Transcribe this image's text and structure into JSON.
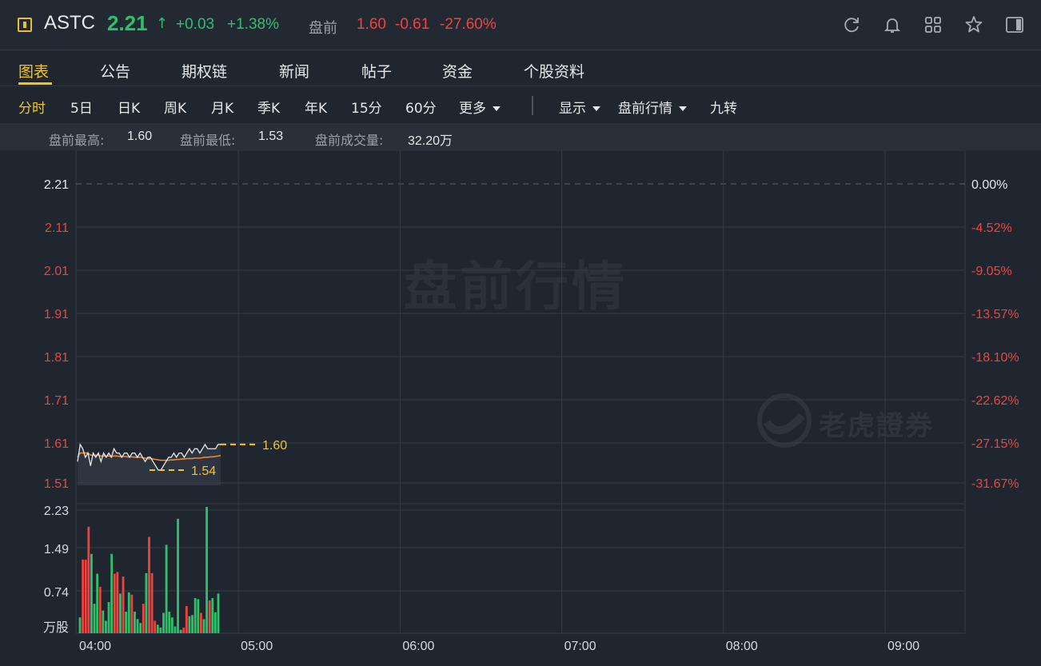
{
  "header": {
    "symbol": "ASTC",
    "price": "2.21",
    "price_arrow": "↑",
    "change": "+0.03",
    "change_pct": "+1.38%",
    "premarket_label": "盘前",
    "premarket_price": "1.60",
    "premarket_change": "-0.61",
    "premarket_change_pct": "-27.60%",
    "icons": [
      "refresh-icon",
      "bell-icon",
      "grid-icon",
      "star-icon",
      "sidebar-toggle-icon"
    ]
  },
  "tabs": [
    {
      "label": "图表",
      "active": true
    },
    {
      "label": "公告",
      "active": false
    },
    {
      "label": "期权链",
      "active": false
    },
    {
      "label": "新闻",
      "active": false
    },
    {
      "label": "帖子",
      "active": false
    },
    {
      "label": "资金",
      "active": false
    },
    {
      "label": "个股资料",
      "active": false
    }
  ],
  "toolbar": {
    "periods": [
      "分时",
      "5日",
      "日K",
      "周K",
      "月K",
      "季K",
      "年K",
      "15分",
      "60分"
    ],
    "active_period": "分时",
    "more": "更多",
    "display": "显示",
    "premarket": "盘前行情",
    "nine_turn": "九转"
  },
  "stats": {
    "high_label": "盘前最高:",
    "high_value": "1.60",
    "low_label": "盘前最低:",
    "low_value": "1.53",
    "volume_label": "盘前成交量:",
    "volume_value": "32.20万"
  },
  "chart": {
    "watermark": "盘前行情",
    "brand_watermark": "老虎證券",
    "colors": {
      "up": "#f0433f",
      "down": "#2fc06a",
      "accent": "#f5c518",
      "avg_line": "#e88a2c",
      "price_line": "#e6e8ea"
    }
  },
  "chart_data": {
    "type": "line",
    "price_axis_left": [
      "2.21",
      "2.11",
      "2.01",
      "1.91",
      "1.81",
      "1.71",
      "1.61",
      "1.51"
    ],
    "price_axis_right": [
      "0.00%",
      "-4.52%",
      "-9.05%",
      "-13.57%",
      "-18.10%",
      "-22.62%",
      "-27.15%",
      "-31.67%"
    ],
    "volume_axis": [
      "2.23",
      "1.49",
      "0.74",
      "万股"
    ],
    "time_axis": [
      "04:00",
      "05:00",
      "06:00",
      "07:00",
      "08:00",
      "09:00"
    ],
    "ylim": [
      1.49,
      2.23
    ],
    "prev_close": 2.21,
    "high_marker": "1.60",
    "low_marker": "1.54",
    "price": [
      1.56,
      1.6,
      1.59,
      1.57,
      1.58,
      1.55,
      1.58,
      1.57,
      1.58,
      1.56,
      1.58,
      1.57,
      1.58,
      1.57,
      1.59,
      1.58,
      1.58,
      1.57,
      1.58,
      1.58,
      1.57,
      1.58,
      1.58,
      1.57,
      1.58,
      1.57,
      1.56,
      1.57,
      1.57,
      1.56,
      1.55,
      1.54,
      1.54,
      1.55,
      1.56,
      1.57,
      1.57,
      1.58,
      1.57,
      1.58,
      1.58,
      1.57,
      1.58,
      1.59,
      1.58,
      1.59,
      1.59,
      1.58,
      1.59,
      1.6,
      1.59,
      1.59,
      1.59,
      1.59,
      1.6,
      1.6
    ],
    "avg": [
      1.57,
      1.58,
      1.58,
      1.58,
      1.58,
      1.575,
      1.575,
      1.575,
      1.575,
      1.573,
      1.573,
      1.573,
      1.573,
      1.572,
      1.573,
      1.573,
      1.572,
      1.572,
      1.572,
      1.571,
      1.571,
      1.571,
      1.57,
      1.57,
      1.57,
      1.569,
      1.568,
      1.567,
      1.567,
      1.566,
      1.565,
      1.564,
      1.563,
      1.563,
      1.563,
      1.563,
      1.564,
      1.564,
      1.565,
      1.565,
      1.566,
      1.566,
      1.567,
      1.567,
      1.567,
      1.568,
      1.568,
      1.568,
      1.569,
      1.57,
      1.57,
      1.571,
      1.571,
      1.572,
      1.573,
      1.574
    ],
    "volume_max": 2.23,
    "volume": [
      [
        0.28,
        "down"
      ],
      [
        1.3,
        "up"
      ],
      [
        1.3,
        "up"
      ],
      [
        1.88,
        "up"
      ],
      [
        1.4,
        "down"
      ],
      [
        0.52,
        "down"
      ],
      [
        1.05,
        "down"
      ],
      [
        0.82,
        "up"
      ],
      [
        0.4,
        "down"
      ],
      [
        0.22,
        "down"
      ],
      [
        0.55,
        "down"
      ],
      [
        1.4,
        "down"
      ],
      [
        1.05,
        "up"
      ],
      [
        1.08,
        "up"
      ],
      [
        0.7,
        "down"
      ],
      [
        1.0,
        "up"
      ],
      [
        0.38,
        "down"
      ],
      [
        0.72,
        "down"
      ],
      [
        0.68,
        "up"
      ],
      [
        0.38,
        "down"
      ],
      [
        0.25,
        "down"
      ],
      [
        0.18,
        "down"
      ],
      [
        0.52,
        "up"
      ],
      [
        1.06,
        "down"
      ],
      [
        1.7,
        "up"
      ],
      [
        1.06,
        "up"
      ],
      [
        0.22,
        "up"
      ],
      [
        0.15,
        "down"
      ],
      [
        0.1,
        "down"
      ],
      [
        0.36,
        "down"
      ],
      [
        1.56,
        "down"
      ],
      [
        0.38,
        "down"
      ],
      [
        0.28,
        "down"
      ],
      [
        0.12,
        "down"
      ],
      [
        2.02,
        "down"
      ],
      [
        0.06,
        "down"
      ],
      [
        0.1,
        "up"
      ],
      [
        0.48,
        "up"
      ],
      [
        0.3,
        "down"
      ],
      [
        0.32,
        "down"
      ],
      [
        0.62,
        "down"
      ],
      [
        0.6,
        "down"
      ],
      [
        0.36,
        "up"
      ],
      [
        0.25,
        "down"
      ],
      [
        2.23,
        "down"
      ],
      [
        0.58,
        "up"
      ],
      [
        0.62,
        "down"
      ],
      [
        0.37,
        "down"
      ],
      [
        0.7,
        "down"
      ]
    ]
  }
}
